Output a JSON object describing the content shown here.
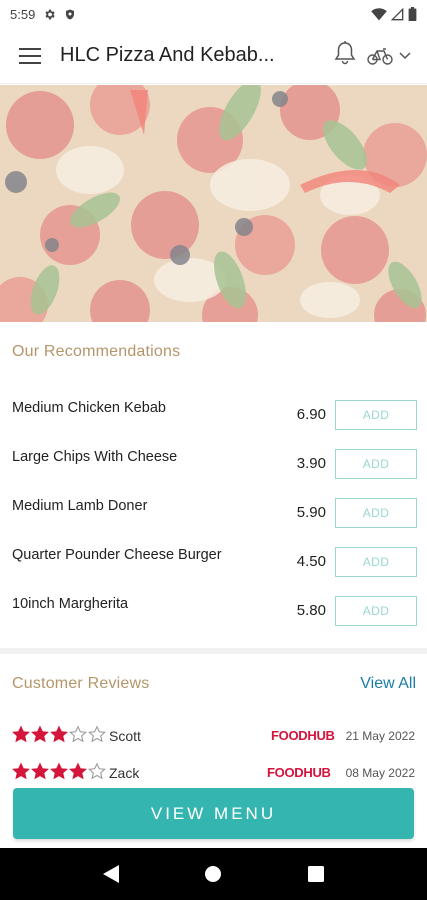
{
  "status_bar": {
    "time": "5:59"
  },
  "app_bar": {
    "title": "HLC Pizza And Kebab..."
  },
  "recommendations": {
    "title": "Our Recommendations",
    "add_label": "ADD",
    "items": [
      {
        "name": "Medium Chicken Kebab",
        "price": "6.90"
      },
      {
        "name": "Large Chips With Cheese",
        "price": "3.90"
      },
      {
        "name": "Medium Lamb Doner",
        "price": "5.90"
      },
      {
        "name": "Quarter Pounder Cheese Burger",
        "price": "4.50"
      },
      {
        "name": "10inch Margherita",
        "price": "5.80"
      }
    ]
  },
  "reviews": {
    "title": "Customer Reviews",
    "view_all": "View All",
    "items": [
      {
        "name": "Scott",
        "rating": 3,
        "max_rating": 5,
        "source": "FOODHUB",
        "date": "21 May 2022"
      },
      {
        "name": "Zack",
        "rating": 4,
        "max_rating": 5,
        "source": "FOODHUB",
        "date": "08 May 2022"
      }
    ]
  },
  "cta": {
    "label": "VIEW MENU"
  },
  "colors": {
    "accent": "#35b5b0",
    "section_title": "#b4966a",
    "link": "#1b7ea6",
    "star": "#d4143a",
    "brand": "#d4143a"
  },
  "icons": {
    "status": [
      "gear-icon",
      "shield-icon",
      "wifi-icon",
      "signal-icon",
      "battery-icon"
    ],
    "app_bar": [
      "menu-icon",
      "bell-icon",
      "bicycle-icon",
      "chevron-down-icon"
    ],
    "nav": [
      "back-icon",
      "home-icon",
      "recents-icon"
    ]
  }
}
